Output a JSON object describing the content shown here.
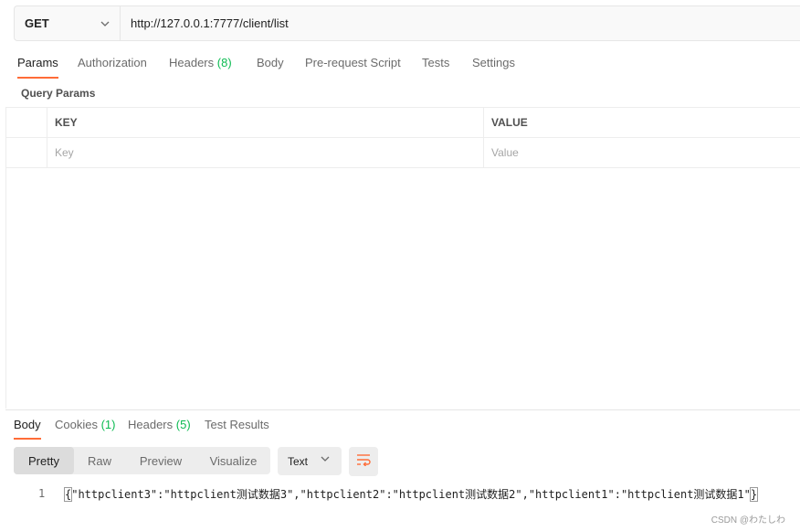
{
  "request": {
    "method": "GET",
    "url": "http://127.0.0.1:7777/client/list"
  },
  "request_tabs": {
    "params": "Params",
    "authorization": "Authorization",
    "headers_label": "Headers",
    "headers_count": "(8)",
    "body": "Body",
    "prerequest": "Pre-request Script",
    "tests": "Tests",
    "settings": "Settings"
  },
  "query_params": {
    "title": "Query Params",
    "key_header": "KEY",
    "value_header": "VALUE",
    "key_placeholder": "Key",
    "value_placeholder": "Value"
  },
  "response_tabs": {
    "body": "Body",
    "cookies_label": "Cookies",
    "cookies_count": "(1)",
    "headers_label": "Headers",
    "headers_count": "(5)",
    "test_results": "Test Results"
  },
  "view_modes": {
    "pretty": "Pretty",
    "raw": "Raw",
    "preview": "Preview",
    "visualize": "Visualize"
  },
  "format": "Text",
  "response_body": {
    "line_number": "1",
    "open_brace": "{",
    "content": "\"httpclient3\":\"httpclient测试数据3\",\"httpclient2\":\"httpclient测试数据2\",\"httpclient1\":\"httpclient测试数据1\"",
    "close_brace": "}"
  },
  "watermark": "CSDN @わたしわ",
  "colors": {
    "accent": "#ff6c37",
    "count_green": "#0cbb52"
  },
  "icons": [
    "chevron-down-icon",
    "wrap-lines-icon"
  ]
}
